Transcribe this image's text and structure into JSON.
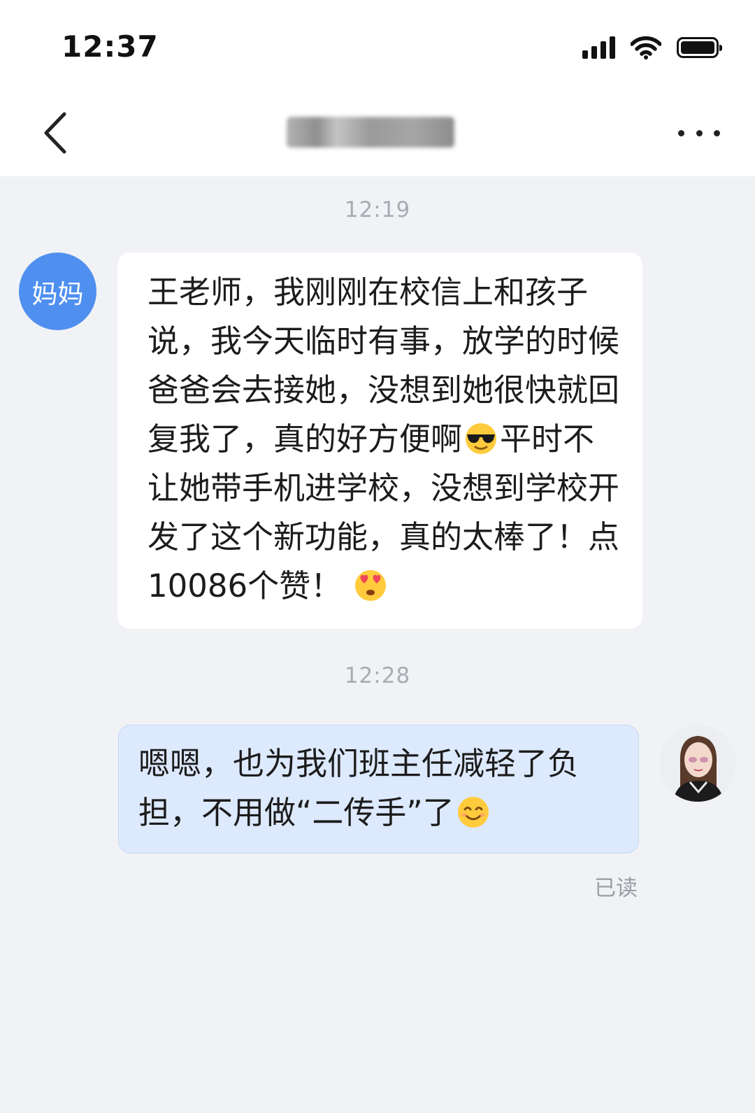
{
  "status_bar": {
    "time": "12:37",
    "icons": [
      "cellular-signal-icon",
      "wifi-icon",
      "battery-icon"
    ]
  },
  "nav": {
    "back_icon": "chevron-left-icon",
    "title": "",
    "more_icon": "more-dots-icon"
  },
  "messages": [
    {
      "timestamp": "12:19",
      "sender_avatar_label": "妈妈",
      "text_part1": "王老师，我刚刚在校信上和孩子说，我今天临时有事，放学的时候爸爸会去接她，没想到她很快就回复我了，真的好方便啊",
      "emoji1": "sunglasses-emoji-icon",
      "text_part2": "平时不让她带手机进学校，没想到学校开发了这个新功能，真的太棒了！点10086个赞！",
      "emoji2": "heart-eyes-emoji-icon"
    },
    {
      "timestamp": "12:28",
      "text": "嗯嗯，也为我们班主任减轻了负担，不用做“二传手”了",
      "emoji": "smiling-emoji-icon",
      "read_status": "已读"
    }
  ],
  "colors": {
    "background": "#f1f2f5",
    "avatar_blue": "#4f8ff0",
    "own_bubble": "#dde9fd",
    "timestamp_gray": "#a8abb2"
  }
}
